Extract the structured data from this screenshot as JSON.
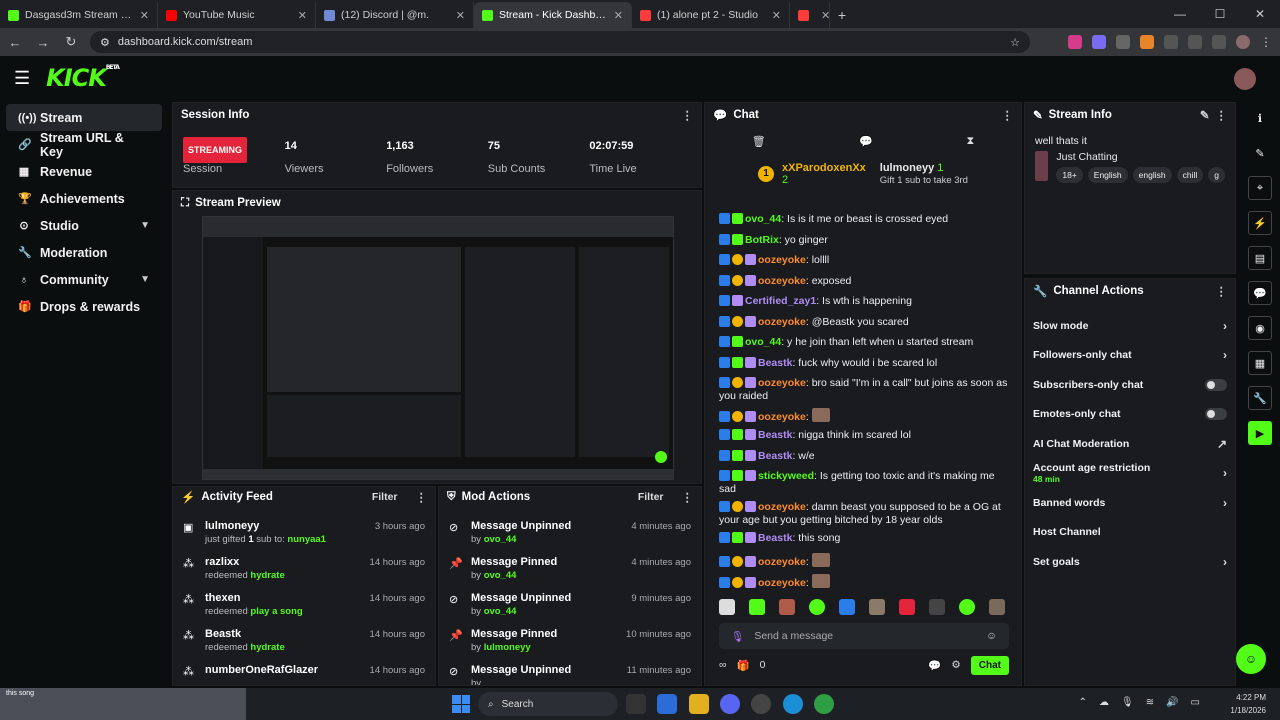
{
  "browser": {
    "tabs": [
      {
        "title": "Dasgasd3m Stream - Watch Liv",
        "color": "#53fc18"
      },
      {
        "title": "YouTube Music",
        "color": "#ff0000"
      },
      {
        "title": "(12) Discord | @m.",
        "color": "#7289da"
      },
      {
        "title": "Stream - Kick Dashboard",
        "color": "#53fc18",
        "active": true
      },
      {
        "title": "(1) alone pt 2 - Studio",
        "color": "#ff3b3b"
      },
      {
        "title": "",
        "color": "#ff3b3b"
      }
    ],
    "url": "dashboard.kick.com/stream"
  },
  "brand": {
    "logo": "KICK",
    "beta": "BETA",
    "accent": "#53fc18"
  },
  "sidebar": {
    "items": [
      {
        "label": "Stream",
        "icon": "stream-icon",
        "glyph": "((•))"
      },
      {
        "label": "Stream URL & Key",
        "icon": "link-icon",
        "glyph": "🔗"
      },
      {
        "label": "Revenue",
        "icon": "revenue-icon",
        "glyph": "▦"
      },
      {
        "label": "Achievements",
        "icon": "trophy-icon",
        "glyph": "🏆"
      },
      {
        "label": "Studio",
        "icon": "studio-icon",
        "glyph": "⊙"
      },
      {
        "label": "Moderation",
        "icon": "wrench-icon",
        "glyph": "🔧"
      },
      {
        "label": "Community",
        "icon": "community-icon",
        "glyph": "♁"
      },
      {
        "label": "Drops & rewards",
        "icon": "gift-icon",
        "glyph": "🎁"
      }
    ]
  },
  "session": {
    "title": "Session Info",
    "status": "STREAMING",
    "status_label": "Session",
    "stats": [
      {
        "value": "14",
        "label": "Viewers"
      },
      {
        "value": "1,163",
        "label": "Followers"
      },
      {
        "value": "75",
        "label": "Sub Counts"
      },
      {
        "value": "02:07:59",
        "label": "Time Live"
      }
    ]
  },
  "preview": {
    "title": "Stream Preview"
  },
  "activity": {
    "title": "Activity Feed",
    "filter": "Filter",
    "items": [
      {
        "name": "lulmoneyy",
        "pre": "just gifted ",
        "mid": "1",
        "post": " sub to: ",
        "hl": "nunyaa1",
        "time": "3 hours ago"
      },
      {
        "name": "razlixx",
        "pre": "redeemed ",
        "mid": "",
        "post": "",
        "hl": "hydrate",
        "time": "14 hours ago"
      },
      {
        "name": "thexen",
        "pre": "redeemed ",
        "mid": "",
        "post": "",
        "hl": "play a song",
        "time": "14 hours ago"
      },
      {
        "name": "Beastk",
        "pre": "redeemed ",
        "mid": "",
        "post": "",
        "hl": "hydrate",
        "time": "14 hours ago"
      },
      {
        "name": "numberOneRafGlazer",
        "pre": "",
        "mid": "",
        "post": "",
        "hl": "",
        "time": "14 hours ago"
      }
    ]
  },
  "mod": {
    "title": "Mod Actions",
    "filter": "Filter",
    "items": [
      {
        "action": "Message Unpinned",
        "by": "ovo_44",
        "time": "4 minutes ago",
        "icon": "unpin-icon",
        "glyph": "⊘"
      },
      {
        "action": "Message Pinned",
        "by": "ovo_44",
        "time": "4 minutes ago",
        "icon": "pin-icon",
        "glyph": "📌"
      },
      {
        "action": "Message Unpinned",
        "by": "ovo_44",
        "time": "9 minutes ago",
        "icon": "unpin-icon",
        "glyph": "⊘"
      },
      {
        "action": "Message Pinned",
        "by": "lulmoneyy",
        "time": "10 minutes ago",
        "icon": "pin-icon",
        "glyph": "📌"
      },
      {
        "action": "Message Unpinned",
        "by": "",
        "time": "11 minutes ago",
        "icon": "unpin-icon",
        "glyph": "⊘"
      }
    ],
    "by_prefix": "by "
  },
  "chat": {
    "title": "Chat",
    "pinned": {
      "user1": "xXParodoxenXx",
      "count1": "2",
      "user2": "lulmoneyy",
      "count2": "1",
      "gift": "Gift 1 sub to take 3rd"
    },
    "messages": [
      {
        "badges": [
          "k",
          "g"
        ],
        "user": "ovo_44",
        "color": "#53fc18",
        "text": ": Is is it me or beast is crossed eyed"
      },
      {
        "badges": [
          "k",
          "g"
        ],
        "user": "BotRix",
        "color": "#53fc18",
        "text": ": yo ginger"
      },
      {
        "badges": [
          "k",
          "o",
          "p"
        ],
        "user": "oozeyoke",
        "color": "#ff8c2a",
        "text": ": lollll"
      },
      {
        "badges": [
          "k",
          "o",
          "p"
        ],
        "user": "oozeyoke",
        "color": "#ff8c2a",
        "text": ": exposed"
      },
      {
        "badges": [
          "k",
          "p"
        ],
        "user": "Certified_zay1",
        "color": "#b08cf5",
        "text": ": Is wth is happening"
      },
      {
        "badges": [
          "k",
          "o",
          "p"
        ],
        "user": "oozeyoke",
        "color": "#ff8c2a",
        "text": ": @Beastk you scared"
      },
      {
        "badges": [
          "k",
          "g"
        ],
        "user": "ovo_44",
        "color": "#53fc18",
        "text": ": y he join than left when u started stream"
      },
      {
        "badges": [
          "k",
          "g",
          "p"
        ],
        "user": "Beastk",
        "color": "#b08cf5",
        "text": ": fuck why would i be scared lol"
      },
      {
        "badges": [
          "k",
          "o",
          "p"
        ],
        "user": "oozeyoke",
        "color": "#ff8c2a",
        "text": ": bro said \"I'm in a call\" but joins as soon as you raided"
      },
      {
        "badges": [
          "k",
          "o",
          "p"
        ],
        "user": "oozeyoke",
        "color": "#ff8c2a",
        "text": ": "
      },
      {
        "badges": [
          "k",
          "g",
          "p"
        ],
        "user": "Beastk",
        "color": "#b08cf5",
        "text": ": nigga think im scared lol"
      },
      {
        "badges": [
          "k",
          "g",
          "p"
        ],
        "user": "Beastk",
        "color": "#b08cf5",
        "text": ": w/e"
      },
      {
        "badges": [
          "k",
          "g",
          "p"
        ],
        "user": "stickyweed",
        "color": "#53fc18",
        "text": ": Is getting too toxic and it's making me sad"
      },
      {
        "badges": [
          "k",
          "o",
          "p"
        ],
        "user": "oozeyoke",
        "color": "#ff8c2a",
        "text": ": damn beast you supposed to be a OG at your age but you getting bitched by 18 year olds"
      },
      {
        "badges": [
          "k",
          "g",
          "p"
        ],
        "user": "Beastk",
        "color": "#b08cf5",
        "text": ": this song"
      },
      {
        "badges": [
          "k",
          "o",
          "p"
        ],
        "user": "oozeyoke",
        "color": "#ff8c2a",
        "text": ": "
      },
      {
        "badges": [
          "k",
          "o",
          "p"
        ],
        "user": "oozeyoke",
        "color": "#ff8c2a",
        "text": ": "
      }
    ],
    "input_placeholder": "Send a message",
    "footer_count": "0",
    "send": "Chat"
  },
  "stream_info": {
    "title": "Stream Info",
    "stream_title": "well thats it",
    "category": "Just Chatting",
    "tags": [
      "18+",
      "English",
      "english",
      "chill",
      "g"
    ]
  },
  "channel_actions": {
    "title": "Channel Actions",
    "items": [
      {
        "label": "Slow mode",
        "control": "chevron"
      },
      {
        "label": "Followers-only chat",
        "control": "chevron"
      },
      {
        "label": "Subscribers-only chat",
        "control": "toggle"
      },
      {
        "label": "Emotes-only chat",
        "control": "toggle"
      },
      {
        "label": "AI Chat Moderation",
        "control": "external"
      },
      {
        "label": "Account age restriction",
        "sub": "48 min",
        "control": "chevron"
      },
      {
        "label": "Banned words",
        "control": "chevron"
      },
      {
        "label": "Host Channel",
        "control": "none"
      },
      {
        "label": "Set goals",
        "control": "chevron"
      }
    ]
  },
  "taskbar": {
    "search": "Search",
    "time": "4:22 PM",
    "date": "1/18/2026",
    "overlay": "this song"
  }
}
